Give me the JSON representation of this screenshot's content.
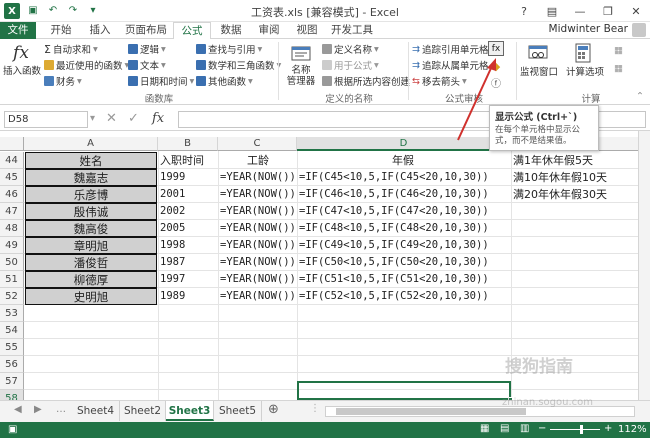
{
  "window": {
    "title": "工资表.xls  [兼容模式] - Excel",
    "user": "Midwinter Bear"
  },
  "tabs": [
    "文件",
    "开始",
    "插入",
    "页面布局",
    "公式",
    "数据",
    "审阅",
    "视图",
    "开发工具"
  ],
  "ribbon": {
    "insert_fn": "插入函数",
    "autosum": "自动求和",
    "recent": "最近使用的函数",
    "financial": "财务",
    "logical": "逻辑",
    "text": "文本",
    "datetime": "日期和时间",
    "lookup": "查找与引用",
    "math": "数学和三角函数",
    "more": "其他函数",
    "group_fnlib": "函数库",
    "name_mgr": "名称\n管理器",
    "define_name": "定义名称",
    "use_in_formula": "用于公式",
    "create_from_sel": "根据所选内容创建",
    "group_names": "定义的名称",
    "trace_prec": "追踪引用单元格",
    "trace_dep": "追踪从属单元格",
    "remove_arrows": "移去箭头",
    "group_audit": "公式审核",
    "watch": "监视窗口",
    "calc_options": "计算选项",
    "group_calc": "计算"
  },
  "tooltip": {
    "title": "显示公式 (Ctrl+`)",
    "desc": "在每个单元格中显示公式，而不是结果值。"
  },
  "name_box": "D58",
  "columns": [
    "A",
    "B",
    "C",
    "D"
  ],
  "rows": [
    "44",
    "45",
    "46",
    "47",
    "48",
    "49",
    "50",
    "51",
    "52",
    "53",
    "54",
    "55",
    "56",
    "57",
    "58"
  ],
  "headers": {
    "name": "姓名",
    "hire": "入职时间",
    "tenure": "工龄",
    "leave": "年假"
  },
  "records": [
    {
      "name": "魏嘉志",
      "year": "1999",
      "tenure": "=YEAR(NOW())",
      "leave": "=IF(C45<10,5,IF(C45<20,10,30))"
    },
    {
      "name": "乐彦博",
      "year": "2001",
      "tenure": "=YEAR(NOW())",
      "leave": "=IF(C46<10,5,IF(C46<20,10,30))"
    },
    {
      "name": "殷伟诚",
      "year": "2002",
      "tenure": "=YEAR(NOW())",
      "leave": "=IF(C47<10,5,IF(C47<20,10,30))"
    },
    {
      "name": "魏高俊",
      "year": "2005",
      "tenure": "=YEAR(NOW())",
      "leave": "=IF(C48<10,5,IF(C48<20,10,30))"
    },
    {
      "name": "章明旭",
      "year": "1998",
      "tenure": "=YEAR(NOW())",
      "leave": "=IF(C49<10,5,IF(C49<20,10,30))"
    },
    {
      "name": "潘俊哲",
      "year": "1987",
      "tenure": "=YEAR(NOW())",
      "leave": "=IF(C50<10,5,IF(C50<20,10,30))"
    },
    {
      "name": "柳德厚",
      "year": "1997",
      "tenure": "=YEAR(NOW())",
      "leave": "=IF(C51<10,5,IF(C51<20,10,30))"
    },
    {
      "name": "史明旭",
      "year": "1989",
      "tenure": "=YEAR(NOW())",
      "leave": "=IF(C52<10,5,IF(C52<20,10,30))"
    }
  ],
  "notes": [
    "满1年休年假5天",
    "满10年休年假10天",
    "满20年休年假30天"
  ],
  "sheets": [
    "Sheet4",
    "Sheet2",
    "Sheet3",
    "Sheet5"
  ],
  "active_sheet": "Sheet3",
  "zoom": "112%",
  "watermark": "搜狗指南",
  "watermark_url": "zhinan.sogou.com",
  "colors": {
    "accent": "#217346",
    "arrow": "#d0312d"
  }
}
